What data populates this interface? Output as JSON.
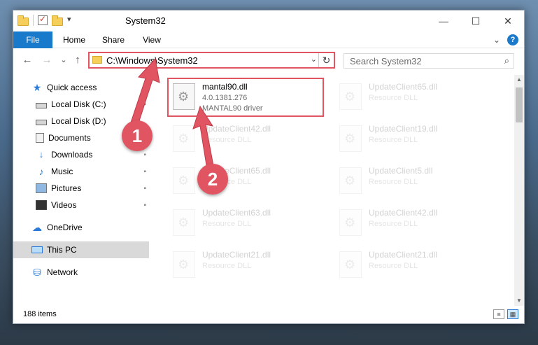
{
  "window": {
    "title": "System32",
    "controls": {
      "minimize": "—",
      "maximize": "☐",
      "close": "✕"
    }
  },
  "ribbon": {
    "tabs": [
      "File",
      "Home",
      "Share",
      "View"
    ],
    "collapse": "⌄",
    "help": "?"
  },
  "nav": {
    "back": "←",
    "forward": "→",
    "recent": "⌄",
    "up": "↑",
    "address": "C:\\Windows\\System32",
    "address_dropdown": "⌄",
    "refresh": "↻",
    "search_placeholder": "Search System32",
    "search_icon": "⌕"
  },
  "sidebar": {
    "items": [
      {
        "label": "Quick access",
        "icon": "star-icon"
      },
      {
        "label": "Local Disk (C:)",
        "icon": "disk-icon"
      },
      {
        "label": "Local Disk (D:)",
        "icon": "disk-icon"
      },
      {
        "label": "Documents",
        "icon": "documents-icon"
      },
      {
        "label": "Downloads",
        "icon": "download-icon"
      },
      {
        "label": "Music",
        "icon": "music-icon"
      },
      {
        "label": "Pictures",
        "icon": "pictures-icon"
      },
      {
        "label": "Videos",
        "icon": "videos-icon"
      },
      {
        "label": "OneDrive",
        "icon": "cloud-icon"
      },
      {
        "label": "This PC",
        "icon": "computer-icon"
      },
      {
        "label": "Network",
        "icon": "network-icon"
      }
    ],
    "pin_glyph": "📌"
  },
  "files": [
    {
      "name": "mantal90.dll",
      "line1": "4.0.1381.276",
      "line2": "MANTAL90 driver"
    },
    {
      "name": "UpdateClient65.dll",
      "line1": "Resource DLL"
    },
    {
      "name": "UpdateClient42.dll",
      "line1": "Resource DLL"
    },
    {
      "name": "UpdateClient19.dll",
      "line1": "Resource DLL"
    },
    {
      "name": "UpdateClient65.dll",
      "line1": "Resource DLL"
    },
    {
      "name": "UpdateClient5.dll",
      "line1": "Resource DLL"
    },
    {
      "name": "UpdateClient63.dll",
      "line1": "Resource DLL"
    },
    {
      "name": "UpdateClient42.dll",
      "line1": "Resource DLL"
    },
    {
      "name": "UpdateClient21.dll",
      "line1": "Resource DLL"
    },
    {
      "name": "UpdateClient21.dll",
      "line1": "Resource DLL"
    }
  ],
  "status": {
    "items_count": "188 items"
  },
  "annotations": {
    "badge1": "1",
    "badge2": "2",
    "color": "#e05561"
  },
  "colors": {
    "accent": "#1979ca",
    "highlight": "#e05561"
  }
}
